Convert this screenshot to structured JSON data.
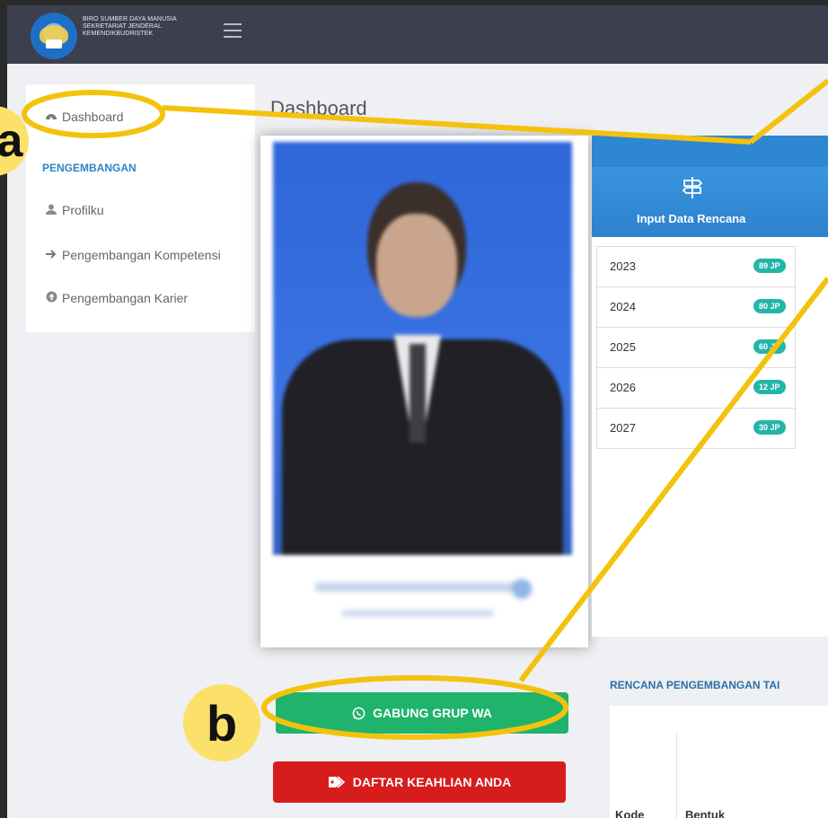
{
  "header": {
    "org_lines": [
      "BIRO SUMBER DAYA MANUSIA",
      "SEKRETARIAT JENDERAL",
      "KEMENDIKBUDRISTEK"
    ]
  },
  "sidebar": {
    "dashboard": "Dashboard",
    "section": "PENGEMBANGAN",
    "items": [
      "Profilku",
      "Pengembangan Kompetensi",
      "Pengembangan Karier"
    ]
  },
  "main": {
    "page_title": "Dashboard",
    "input_tile": "Input Data Rencana",
    "years": [
      {
        "year": "2023",
        "jp": "89 JP"
      },
      {
        "year": "2024",
        "jp": "80 JP"
      },
      {
        "year": "2025",
        "jp": "60 JP"
      },
      {
        "year": "2026",
        "jp": "12 JP"
      },
      {
        "year": "2027",
        "jp": "30 JP"
      }
    ],
    "rencana_title": "RENCANA PENGEMBANGAN TAI",
    "table_headers": [
      "Kode",
      "Bentuk"
    ],
    "btn_wa": "GABUNG GRUP WA",
    "btn_ahli": "DAFTAR KEAHLIAN ANDA"
  },
  "annotations": {
    "marker_a": "a",
    "marker_b": "b",
    "highlight_color": "#f4c20d"
  }
}
